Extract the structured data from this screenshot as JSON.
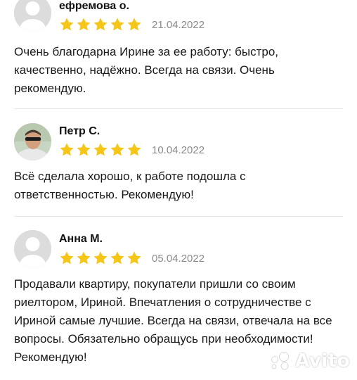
{
  "reviews": [
    {
      "author": "ефремова о.",
      "rating": 5,
      "date": "21.04.2022",
      "text": "Очень благодарна Ирине за ее работу: быстро, качественно, надёжно. Всегда на связи. Очень рекомендую.",
      "avatar": "default-avatar"
    },
    {
      "author": "Петр С.",
      "rating": 5,
      "date": "10.04.2022",
      "text": "Всё сделала хорошо, к работе подошла с ответственностью. Рекомендую!",
      "avatar": "photo-avatar"
    },
    {
      "author": "Анна М.",
      "rating": 5,
      "date": "05.04.2022",
      "text": "Продавали квартиру, покупатели пришли со своим риелтором, Ириной. Впечатления о сотрудничестве с Ириной самые лучшие. Всегда на связи, отвечала на все вопросы. Обязательно обращусь при необходимости! Рекомендую!",
      "avatar": "default-avatar"
    }
  ],
  "watermark": {
    "label": "Avito",
    "icon": "avito-logo-icon"
  },
  "colors": {
    "star": "#f5c518",
    "date": "#8a8a8a",
    "divider": "#e6e6e6",
    "avatar_bg": "#dcdcdc"
  }
}
